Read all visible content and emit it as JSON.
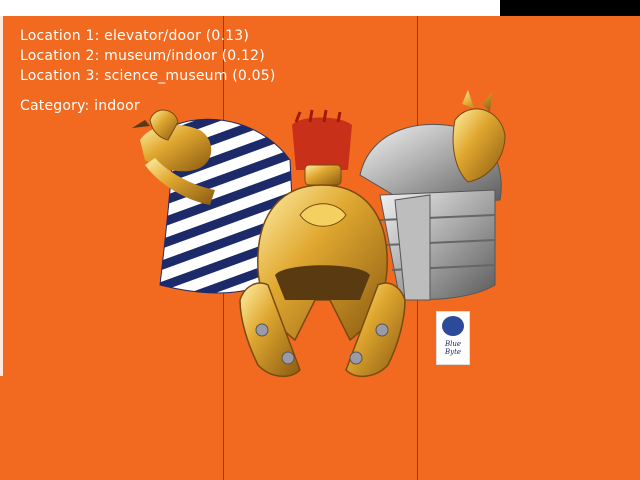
{
  "predictions": [
    {
      "rank_label": "Location 1:",
      "label": "elevator/door",
      "score": "(0.13)"
    },
    {
      "rank_label": "Location 2:",
      "label": "museum/indoor",
      "score": "(0.12)"
    },
    {
      "rank_label": "Location 3:",
      "label": "science_museum",
      "score": "(0.05)"
    }
  ],
  "category": {
    "label": "Category:",
    "value": "indoor"
  },
  "sticker_text": "Blue Byte",
  "colors": {
    "background": "#f26a1f",
    "overlay_text": "#ffffff",
    "sticker_blob": "#2c4a9a"
  },
  "icons": [
    "egyptian-headdress-icon",
    "roman-helmet-icon",
    "samurai-helmet-icon"
  ]
}
